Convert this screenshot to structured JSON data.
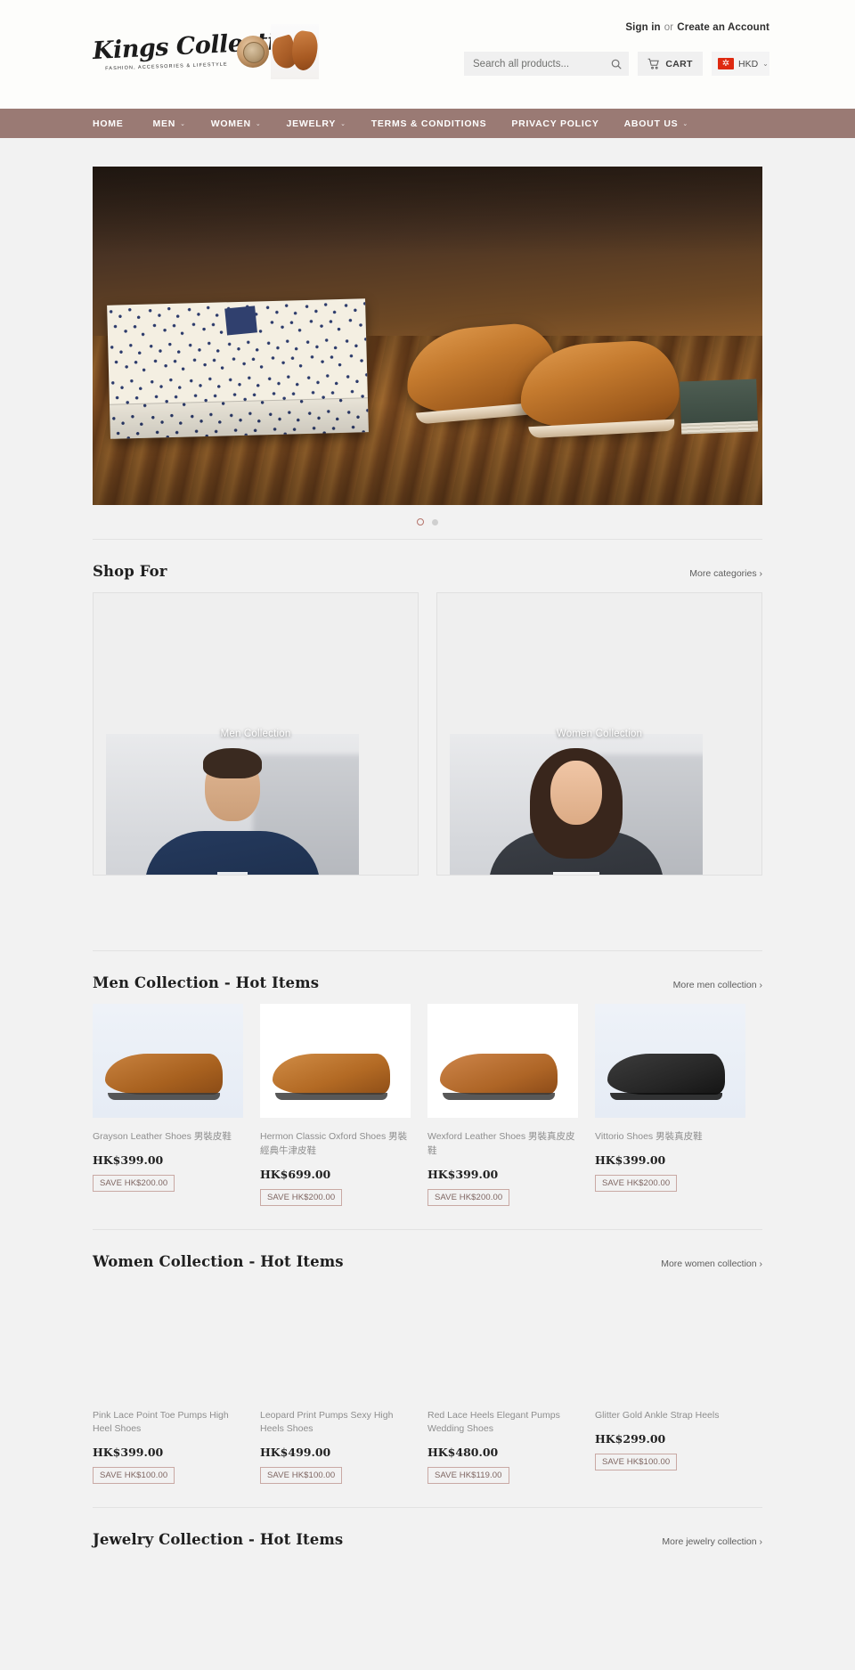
{
  "header": {
    "logo": {
      "script": "Kings Collection",
      "tagline": "FASHION, ACCESSORIES & LIFESTYLE"
    },
    "account": {
      "sign_in": "Sign in",
      "or": "or",
      "create_account": "Create an Account"
    },
    "search": {
      "placeholder": "Search all products...",
      "value": "",
      "icon": "search-icon"
    },
    "cart": {
      "label": "CART",
      "icon": "cart-icon"
    },
    "currency": {
      "value": "HKD",
      "flag": "hong-kong-flag",
      "chevron": "⌄"
    }
  },
  "nav": {
    "items": [
      {
        "label": "HOME",
        "caret": ""
      },
      {
        "label": "MEN",
        "caret": "⌄"
      },
      {
        "label": "WOMEN",
        "caret": "⌄"
      },
      {
        "label": "JEWELRY",
        "caret": "⌄"
      },
      {
        "label": "TERMS & CONDITIONS",
        "caret": ""
      },
      {
        "label": "PRIVACY POLICY",
        "caret": ""
      },
      {
        "label": "ABOUT US",
        "caret": "⌄"
      }
    ]
  },
  "hero": {
    "slides_total": 2,
    "active_slide": 1
  },
  "shop_for": {
    "title": "Shop For",
    "more_link": "More categories ›",
    "tiles": [
      {
        "label": "Men Collection"
      },
      {
        "label": "Women Collection"
      }
    ]
  },
  "men_section": {
    "title": "Men Collection - Hot Items",
    "more_link": "More men collection ›",
    "products": [
      {
        "name": "Grayson Leather Shoes 男裝皮鞋",
        "price": "HK$399.00",
        "save": "SAVE HK$200.00"
      },
      {
        "name": "Hermon Classic Oxford Shoes 男裝經典牛津皮鞋",
        "price": "HK$699.00",
        "save": "SAVE HK$200.00"
      },
      {
        "name": "Wexford Leather Shoes 男裝真皮皮鞋",
        "price": "HK$399.00",
        "save": "SAVE HK$200.00"
      },
      {
        "name": "Vittorio Shoes 男裝真皮鞋",
        "price": "HK$399.00",
        "save": "SAVE HK$200.00"
      }
    ]
  },
  "women_section": {
    "title": "Women Collection - Hot Items",
    "more_link": "More women collection ›",
    "products": [
      {
        "name": "Pink Lace Point Toe Pumps High Heel Shoes",
        "price": "HK$399.00",
        "save": "SAVE HK$100.00"
      },
      {
        "name": "Leopard Print Pumps Sexy High Heels Shoes",
        "price": "HK$499.00",
        "save": "SAVE HK$100.00"
      },
      {
        "name": "Red Lace Heels Elegant Pumps Wedding Shoes",
        "price": "HK$480.00",
        "save": "SAVE HK$119.00"
      },
      {
        "name": "Glitter Gold Ankle Strap Heels",
        "price": "HK$299.00",
        "save": "SAVE HK$100.00"
      }
    ]
  },
  "jewelry_section": {
    "title": "Jewelry Collection - Hot Items",
    "more_link": "More jewelry collection ›"
  }
}
